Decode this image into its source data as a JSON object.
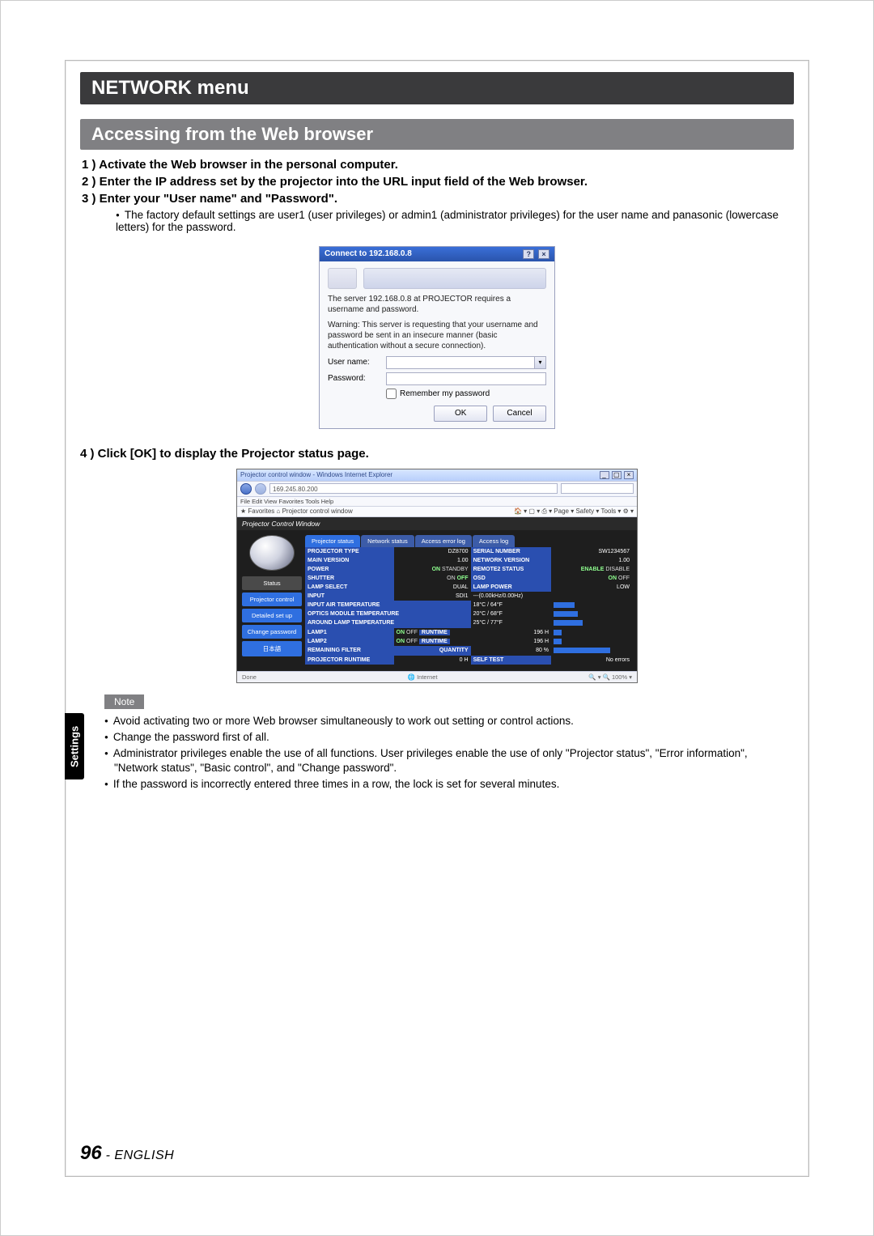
{
  "menu_title": "NETWORK menu",
  "section_title": "Accessing from the Web browser",
  "steps": {
    "s1": "1 ) Activate the Web browser in the personal computer.",
    "s2": "2 ) Enter the IP address set by the projector into the URL input field of the Web browser.",
    "s3": "3 ) Enter your \"User name\" and \"Password\".",
    "s3_note": "The factory default settings are user1 (user privileges) or admin1 (administrator privileges) for the user name and panasonic (lowercase letters) for the password.",
    "s4": "4 ) Click [OK] to display the Projector status page."
  },
  "dialog": {
    "title": "Connect to 192.168.0.8",
    "body_line1": "The server 192.168.0.8 at PROJECTOR requires a username and password.",
    "body_line2": "Warning: This server is requesting that your username and password be sent in an insecure manner (basic authentication without a secure connection).",
    "user_label": "User name:",
    "pass_label": "Password:",
    "remember": "Remember my password",
    "ok": "OK",
    "cancel": "Cancel"
  },
  "browser": {
    "title": "Projector control window - Windows Internet Explorer",
    "url": "169.245.80.200",
    "menu": "File   Edit   View   Favorites   Tools   Help",
    "fav_left": "★ Favorites    ⌂ Projector control window",
    "fav_right": "🏠 ▾  ▢  ▾  ⎙ ▾  Page ▾  Safety ▾  Tools ▾  ⚙ ▾",
    "pcw_header": "Projector Control Window",
    "side": {
      "status": "Status",
      "control": "Projector control",
      "detailed": "Detailed set up",
      "change": "Change password",
      "lang": "日本語"
    },
    "tabs": {
      "t1": "Projector status",
      "t2": "Network status",
      "t3": "Access error log",
      "t4": "Access log"
    },
    "rows": {
      "r1a": "PROJECTOR TYPE",
      "r1b": "DZ8700",
      "r1c": "SERIAL NUMBER",
      "r1d": "SW1234567",
      "r2a": "MAIN VERSION",
      "r2b": "1.00",
      "r2c": "NETWORK VERSION",
      "r2d": "1.00",
      "r3a": "POWER",
      "r3b_on": "ON",
      "r3b_off": "STANDBY",
      "r3c": "REMOTE2 STATUS",
      "r3d_on": "ENABLE",
      "r3d_off": "DISABLE",
      "r4a": "SHUTTER",
      "r4b_on": "ON",
      "r4b_off": "OFF",
      "r4c": "OSD",
      "r4d_on": "ON",
      "r4d_off": "OFF",
      "r5a": "LAMP SELECT",
      "r5b": "DUAL",
      "r5c": "LAMP POWER",
      "r5d": "LOW",
      "r6a": "INPUT",
      "r6b": "SDI1",
      "r6c": "---(0.00kHz/0.00Hz)",
      "r7a": "INPUT AIR TEMPERATURE",
      "r7b": "18°C / 64°F",
      "r8a": "OPTICS MODULE TEMPERATURE",
      "r8b": "20°C / 68°F",
      "r9a": "AROUND LAMP TEMPERATURE",
      "r9b": "25°C / 77°F",
      "r10a": "LAMP1",
      "r10on": "ON",
      "r10off": "OFF",
      "r10rt": "RUNTIME",
      "r10h": "196 H",
      "r11a": "LAMP2",
      "r11h": "196 H",
      "r12a": "REMAINING FILTER",
      "r12q": "QUANTITY",
      "r12v": "80 %",
      "r13a": "PROJECTOR RUNTIME",
      "r13b": "0 H",
      "r13c": "SELF TEST",
      "r13d": "No errors"
    },
    "status_done": "Done",
    "status_inet": "🌐 Internet",
    "status_zoom": "🔍 ▾   🔍 100%  ▾"
  },
  "note_label": "Note",
  "notes": {
    "n1": "Avoid activating two or more Web browser simultaneously to work out setting or control actions.",
    "n2": "Change the password first of all.",
    "n3": "Administrator privileges enable the use of all functions. User privileges enable the use of only \"Projector status\", \"Error information\", \"Network status\", \"Basic control\", and \"Change password\".",
    "n4": "If the password is incorrectly entered three times in a row, the lock is set for several minutes."
  },
  "sidetab": "Settings",
  "footer": {
    "page": "96",
    "dash": " - ",
    "lang": "ENGLISH"
  }
}
